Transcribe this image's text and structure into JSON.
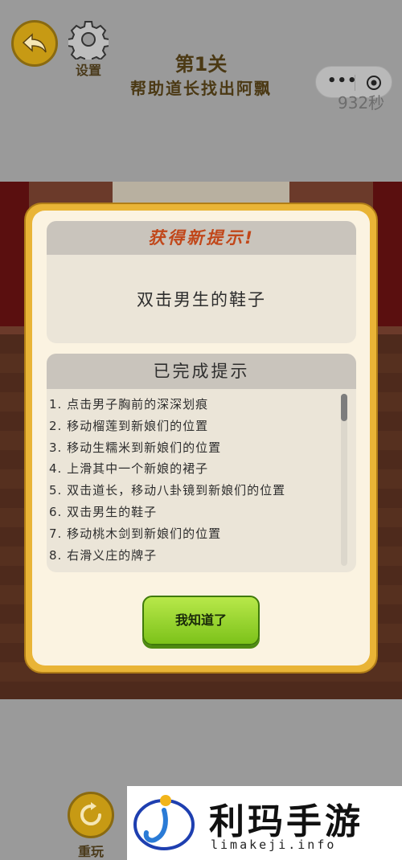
{
  "header": {
    "settings_label": "设置",
    "level_title": "第1关",
    "level_subtitle": "帮助道长找出阿飘",
    "timer": "932秒",
    "capsule_dots": "•••"
  },
  "modal": {
    "new_hint_title": "获得新提示!",
    "new_hint_text": "双击男生的鞋子",
    "completed_title": "已完成提示",
    "completed_items": [
      "1. 点击男子胸前的深深划痕",
      "2. 移动榴莲到新娘们的位置",
      "3. 移动生糯米到新娘们的位置",
      "4. 上滑其中一个新娘的裙子",
      "5. 双击道长，移动八卦镜到新娘们的位置",
      "6. 双击男生的鞋子",
      "7. 移动桃木剑到新娘们的位置",
      "8. 右滑义庄的牌子"
    ],
    "ok_button": "我知道了"
  },
  "footer": {
    "replay_label": "重玩"
  },
  "watermark": {
    "title": "利玛手游",
    "url": "limakeji.info"
  },
  "colors": {
    "modal_border": "#e9b436",
    "hint_title": "#c1471a",
    "ok_button": "#8fd02a",
    "round_button": "#c79a14"
  }
}
